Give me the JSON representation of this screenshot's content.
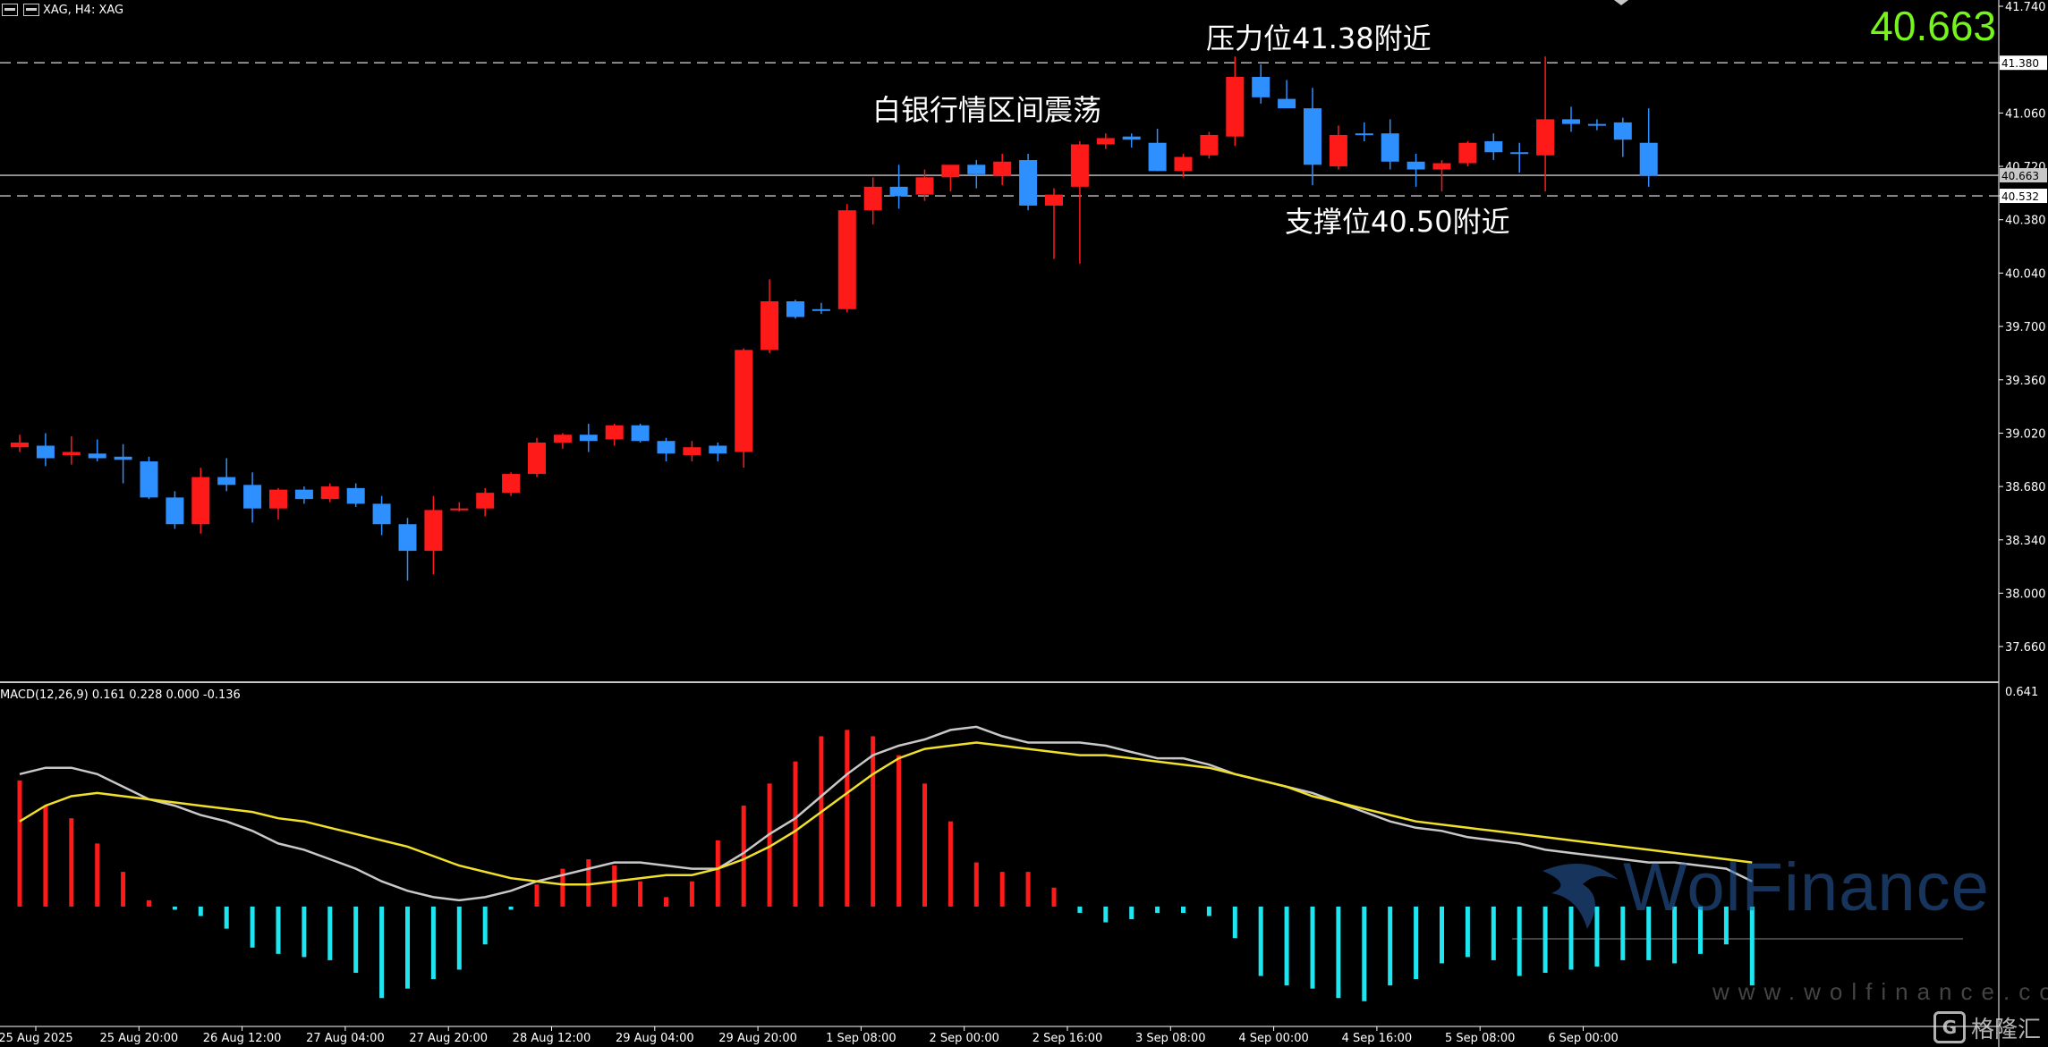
{
  "header": {
    "symbol": "XAG, H4:  XAG"
  },
  "current_price": "40.663",
  "annotations": {
    "range": "白银行情区间震荡",
    "resistance": "压力位41.38附近",
    "support": "支撑位40.50附近"
  },
  "macd": {
    "label": "MACD(12,26,9) 0.161 0.228 0.000 -0.136",
    "scale_top": "0.641"
  },
  "watermark": {
    "brand": "WolFinance",
    "url": "www.wolfinance.com",
    "logo_text": "格隆汇"
  },
  "colors": {
    "background": "#000000",
    "bull": "#ff1a1a",
    "bear": "#2e8fff",
    "macd_pos": "#ff1a1a",
    "macd_neg": "#1ee6f0",
    "macd_line": "#c8c8c8",
    "signal_line": "#f0e02a",
    "price_highlight": "#76f51c"
  },
  "chart_data": {
    "type": "candlestick",
    "timeframe": "H4",
    "y_ticks": [
      "41.740",
      "41.380",
      "41.060",
      "40.720",
      "40.532",
      "40.380",
      "40.040",
      "39.700",
      "39.360",
      "39.020",
      "38.680",
      "38.340",
      "38.000",
      "37.660"
    ],
    "ylim": [
      37.45,
      41.78
    ],
    "x_tick_labels": [
      "25 Aug 2025",
      "25 Aug 20:00",
      "26 Aug 12:00",
      "27 Aug 04:00",
      "27 Aug 20:00",
      "28 Aug 12:00",
      "29 Aug 04:00",
      "29 Aug 20:00",
      "1 Sep 08:00",
      "2 Sep 00:00",
      "2 Sep 16:00",
      "3 Sep 08:00",
      "4 Sep 00:00",
      "4 Sep 16:00",
      "5 Sep 08:00",
      "6 Sep 00:00"
    ],
    "horizontal_levels": [
      {
        "price": 41.38,
        "label": "41.380",
        "style": "dashed"
      },
      {
        "price": 40.532,
        "label": "40.532",
        "style": "dashed"
      },
      {
        "price": 40.663,
        "label": "40.663",
        "style": "solid"
      }
    ],
    "candles": [
      {
        "o": 38.93,
        "h": 39.01,
        "l": 38.9,
        "c": 38.96
      },
      {
        "o": 38.94,
        "h": 39.02,
        "l": 38.81,
        "c": 38.86
      },
      {
        "o": 38.88,
        "h": 39.0,
        "l": 38.82,
        "c": 38.9
      },
      {
        "o": 38.89,
        "h": 38.98,
        "l": 38.84,
        "c": 38.86
      },
      {
        "o": 38.87,
        "h": 38.95,
        "l": 38.7,
        "c": 38.85
      },
      {
        "o": 38.84,
        "h": 38.87,
        "l": 38.6,
        "c": 38.61
      },
      {
        "o": 38.61,
        "h": 38.65,
        "l": 38.41,
        "c": 38.44
      },
      {
        "o": 38.44,
        "h": 38.8,
        "l": 38.38,
        "c": 38.74
      },
      {
        "o": 38.74,
        "h": 38.86,
        "l": 38.65,
        "c": 38.69
      },
      {
        "o": 38.69,
        "h": 38.77,
        "l": 38.45,
        "c": 38.54
      },
      {
        "o": 38.54,
        "h": 38.67,
        "l": 38.47,
        "c": 38.66
      },
      {
        "o": 38.66,
        "h": 38.68,
        "l": 38.57,
        "c": 38.6
      },
      {
        "o": 38.6,
        "h": 38.7,
        "l": 38.58,
        "c": 38.68
      },
      {
        "o": 38.67,
        "h": 38.7,
        "l": 38.55,
        "c": 38.57
      },
      {
        "o": 38.57,
        "h": 38.62,
        "l": 38.37,
        "c": 38.44
      },
      {
        "o": 38.44,
        "h": 38.48,
        "l": 38.08,
        "c": 38.27
      },
      {
        "o": 38.27,
        "h": 38.62,
        "l": 38.12,
        "c": 38.53
      },
      {
        "o": 38.53,
        "h": 38.58,
        "l": 38.52,
        "c": 38.54
      },
      {
        "o": 38.54,
        "h": 38.67,
        "l": 38.49,
        "c": 38.64
      },
      {
        "o": 38.64,
        "h": 38.77,
        "l": 38.62,
        "c": 38.76
      },
      {
        "o": 38.76,
        "h": 38.99,
        "l": 38.74,
        "c": 38.96
      },
      {
        "o": 38.96,
        "h": 39.02,
        "l": 38.92,
        "c": 39.01
      },
      {
        "o": 39.01,
        "h": 39.08,
        "l": 38.9,
        "c": 38.97
      },
      {
        "o": 38.98,
        "h": 39.08,
        "l": 38.94,
        "c": 39.07
      },
      {
        "o": 39.07,
        "h": 39.08,
        "l": 38.96,
        "c": 38.97
      },
      {
        "o": 38.97,
        "h": 38.99,
        "l": 38.84,
        "c": 38.89
      },
      {
        "o": 38.88,
        "h": 38.97,
        "l": 38.84,
        "c": 38.93
      },
      {
        "o": 38.94,
        "h": 38.96,
        "l": 38.84,
        "c": 38.89
      },
      {
        "o": 38.9,
        "h": 39.56,
        "l": 38.8,
        "c": 39.55
      },
      {
        "o": 39.55,
        "h": 40.0,
        "l": 39.53,
        "c": 39.86
      },
      {
        "o": 39.86,
        "h": 39.87,
        "l": 39.75,
        "c": 39.76
      },
      {
        "o": 39.81,
        "h": 39.85,
        "l": 39.78,
        "c": 39.8
      },
      {
        "o": 39.81,
        "h": 40.48,
        "l": 39.79,
        "c": 40.44
      },
      {
        "o": 40.44,
        "h": 40.65,
        "l": 40.35,
        "c": 40.59
      },
      {
        "o": 40.59,
        "h": 40.73,
        "l": 40.45,
        "c": 40.53
      },
      {
        "o": 40.54,
        "h": 40.7,
        "l": 40.5,
        "c": 40.65
      },
      {
        "o": 40.65,
        "h": 40.72,
        "l": 40.56,
        "c": 40.73
      },
      {
        "o": 40.73,
        "h": 40.76,
        "l": 40.58,
        "c": 40.67
      },
      {
        "o": 40.66,
        "h": 40.8,
        "l": 40.6,
        "c": 40.75
      },
      {
        "o": 40.76,
        "h": 40.8,
        "l": 40.44,
        "c": 40.47
      },
      {
        "o": 40.47,
        "h": 40.58,
        "l": 40.13,
        "c": 40.54
      },
      {
        "o": 40.59,
        "h": 40.88,
        "l": 40.1,
        "c": 40.86
      },
      {
        "o": 40.86,
        "h": 40.93,
        "l": 40.83,
        "c": 40.9
      },
      {
        "o": 40.91,
        "h": 40.93,
        "l": 40.84,
        "c": 40.89
      },
      {
        "o": 40.87,
        "h": 40.96,
        "l": 40.69,
        "c": 40.69
      },
      {
        "o": 40.69,
        "h": 40.8,
        "l": 40.65,
        "c": 40.78
      },
      {
        "o": 40.79,
        "h": 40.94,
        "l": 40.77,
        "c": 40.92
      },
      {
        "o": 40.91,
        "h": 41.42,
        "l": 40.85,
        "c": 41.29
      },
      {
        "o": 41.29,
        "h": 41.37,
        "l": 41.12,
        "c": 41.16
      },
      {
        "o": 41.15,
        "h": 41.27,
        "l": 41.1,
        "c": 41.09
      },
      {
        "o": 41.09,
        "h": 41.22,
        "l": 40.6,
        "c": 40.73
      },
      {
        "o": 40.72,
        "h": 40.98,
        "l": 40.7,
        "c": 40.92
      },
      {
        "o": 40.93,
        "h": 41.0,
        "l": 40.88,
        "c": 40.92
      },
      {
        "o": 40.93,
        "h": 41.02,
        "l": 40.7,
        "c": 40.75
      },
      {
        "o": 40.75,
        "h": 40.8,
        "l": 40.59,
        "c": 40.7
      },
      {
        "o": 40.7,
        "h": 40.76,
        "l": 40.56,
        "c": 40.74
      },
      {
        "o": 40.74,
        "h": 40.88,
        "l": 40.72,
        "c": 40.87
      },
      {
        "o": 40.88,
        "h": 40.93,
        "l": 40.76,
        "c": 40.81
      },
      {
        "o": 40.81,
        "h": 40.87,
        "l": 40.68,
        "c": 40.8
      },
      {
        "o": 40.79,
        "h": 41.42,
        "l": 40.56,
        "c": 41.02
      },
      {
        "o": 41.02,
        "h": 41.1,
        "l": 40.94,
        "c": 40.99
      },
      {
        "o": 40.99,
        "h": 41.02,
        "l": 40.95,
        "c": 40.98
      },
      {
        "o": 41.0,
        "h": 41.03,
        "l": 40.78,
        "c": 40.89
      },
      {
        "o": 40.87,
        "h": 41.09,
        "l": 40.59,
        "c": 40.66
      }
    ],
    "macd_panel": {
      "ylim": [
        -0.38,
        0.7
      ],
      "histogram": [
        0.4,
        0.32,
        0.28,
        0.2,
        0.11,
        0.02,
        -0.01,
        -0.03,
        -0.07,
        -0.13,
        -0.15,
        -0.16,
        -0.17,
        -0.21,
        -0.29,
        -0.26,
        -0.23,
        -0.2,
        -0.12,
        -0.01,
        0.07,
        0.12,
        0.15,
        0.13,
        0.08,
        0.03,
        0.08,
        0.21,
        0.32,
        0.39,
        0.46,
        0.54,
        0.56,
        0.54,
        0.48,
        0.39,
        0.27,
        0.14,
        0.11,
        0.11,
        0.06,
        -0.02,
        -0.05,
        -0.04,
        -0.02,
        -0.02,
        -0.03,
        -0.1,
        -0.22,
        -0.25,
        -0.26,
        -0.29,
        -0.3,
        -0.25,
        -0.23,
        -0.18,
        -0.16,
        -0.17,
        -0.22,
        -0.21,
        -0.2,
        -0.19,
        -0.17,
        -0.17,
        -0.18,
        -0.15,
        -0.12,
        -0.25
      ],
      "macd_line": [
        0.42,
        0.44,
        0.44,
        0.42,
        0.38,
        0.34,
        0.32,
        0.29,
        0.27,
        0.24,
        0.2,
        0.18,
        0.15,
        0.12,
        0.08,
        0.05,
        0.03,
        0.02,
        0.03,
        0.05,
        0.08,
        0.1,
        0.12,
        0.14,
        0.14,
        0.13,
        0.12,
        0.12,
        0.17,
        0.23,
        0.28,
        0.35,
        0.42,
        0.48,
        0.51,
        0.53,
        0.56,
        0.57,
        0.54,
        0.52,
        0.52,
        0.52,
        0.51,
        0.49,
        0.47,
        0.47,
        0.45,
        0.42,
        0.4,
        0.38,
        0.36,
        0.33,
        0.3,
        0.27,
        0.25,
        0.24,
        0.22,
        0.21,
        0.2,
        0.18,
        0.17,
        0.16,
        0.15,
        0.14,
        0.14,
        0.13,
        0.12,
        0.08
      ],
      "signal_line": [
        0.27,
        0.32,
        0.35,
        0.36,
        0.35,
        0.34,
        0.33,
        0.32,
        0.31,
        0.3,
        0.28,
        0.27,
        0.25,
        0.23,
        0.21,
        0.19,
        0.16,
        0.13,
        0.11,
        0.09,
        0.08,
        0.07,
        0.07,
        0.08,
        0.09,
        0.1,
        0.1,
        0.12,
        0.15,
        0.19,
        0.24,
        0.3,
        0.36,
        0.42,
        0.47,
        0.5,
        0.51,
        0.52,
        0.51,
        0.5,
        0.49,
        0.48,
        0.48,
        0.47,
        0.46,
        0.45,
        0.44,
        0.42,
        0.4,
        0.38,
        0.35,
        0.33,
        0.31,
        0.29,
        0.27,
        0.26,
        0.25,
        0.24,
        0.23,
        0.22,
        0.21,
        0.2,
        0.19,
        0.18,
        0.17,
        0.16,
        0.15,
        0.14
      ]
    }
  }
}
